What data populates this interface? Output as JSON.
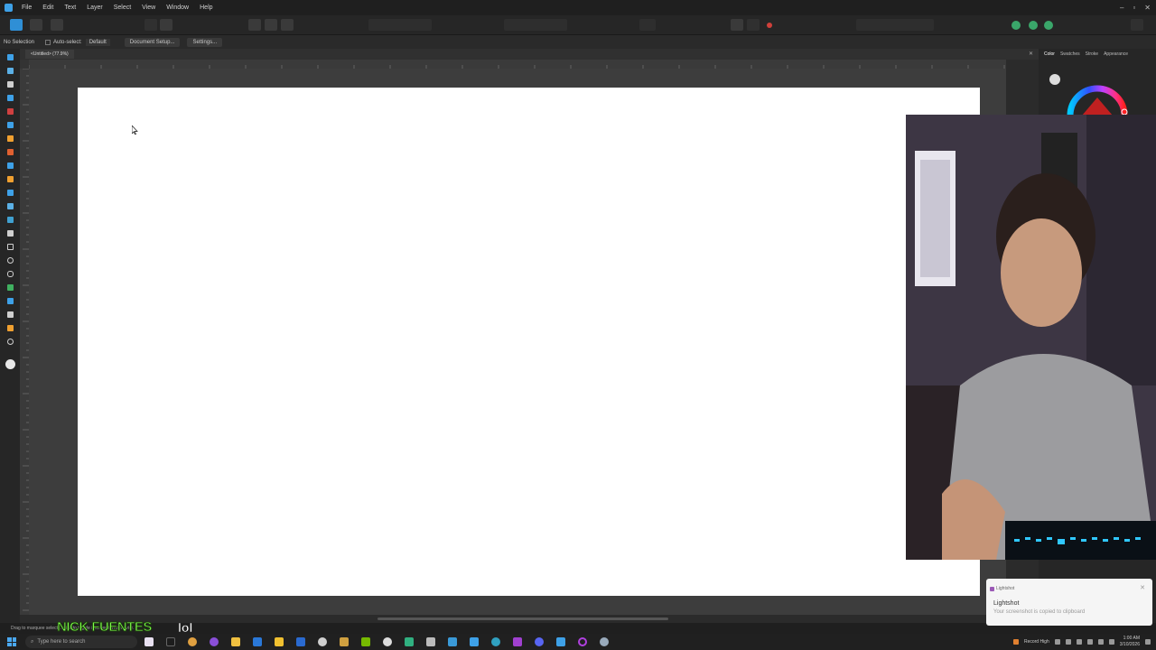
{
  "app": {
    "accent": "#3ea1e8"
  },
  "menu": {
    "items": [
      "File",
      "Edit",
      "Text",
      "Layer",
      "Select",
      "View",
      "Window",
      "Help"
    ]
  },
  "window_controls": {
    "minimize": "–",
    "maximize": "▫",
    "close": "✕"
  },
  "context_bar": {
    "selection": "No Selection",
    "auto_select_label": "Auto-select:",
    "auto_select_value": "Default",
    "document_setup": "Document Setup...",
    "settings": "Settings..."
  },
  "document": {
    "tab_label": "<Untitled> (77.9%)",
    "close_glyph": "✕",
    "artboard_color": "#ffffff"
  },
  "right_panel": {
    "tabs": [
      "Color",
      "Swatches",
      "Stroke",
      "Appearance"
    ],
    "active_tab": "Color"
  },
  "status": {
    "hint": "Drag to marquee select... click to toggle intersection behavior."
  },
  "overlay": {
    "name": "NICK FUENTES",
    "suffix": "lol",
    "name_color": "#7dff4a"
  },
  "notification": {
    "app": "Lightshot",
    "title": "Lightshot",
    "message": "Your screenshot is copied to clipboard",
    "close_glyph": "✕"
  },
  "taskbar": {
    "search_placeholder": "Type here to search",
    "record_label": "Record High",
    "time": "1:00 AM",
    "date": "3/10/2026"
  }
}
